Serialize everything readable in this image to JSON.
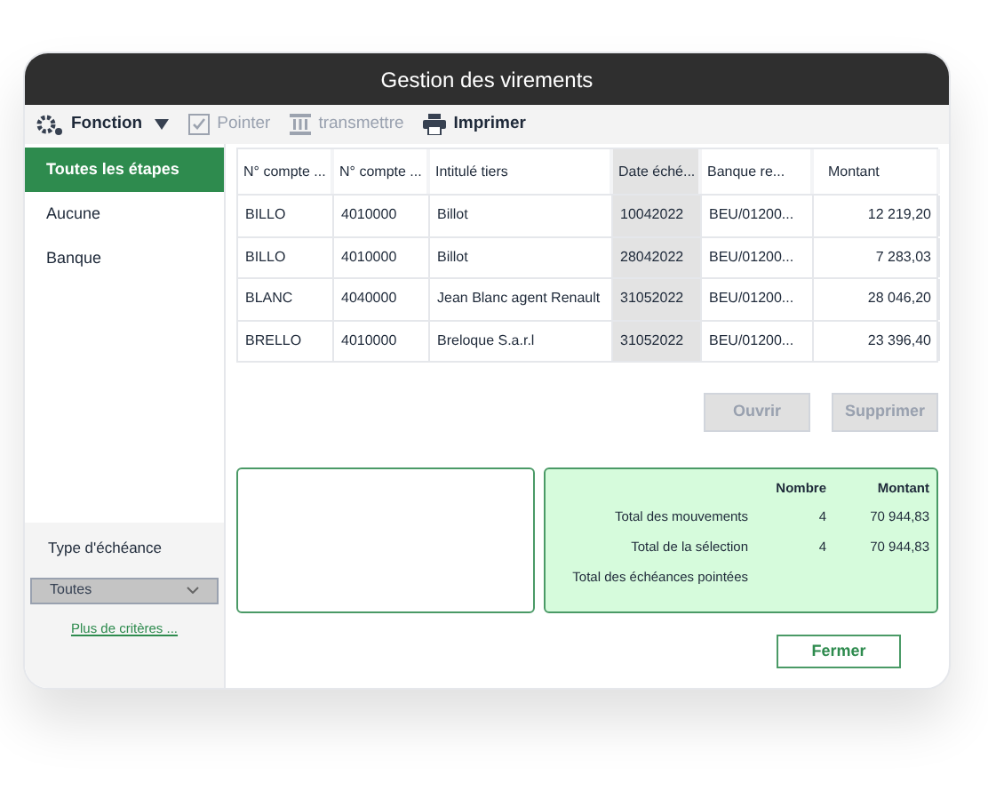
{
  "window": {
    "title": "Gestion des virements"
  },
  "toolbar": [
    {
      "kind": "menu",
      "label": "Fonction",
      "disabled": false
    },
    {
      "kind": "check",
      "label": "Pointer",
      "disabled": true
    },
    {
      "kind": "bank",
      "label": "transmettre",
      "disabled": true
    },
    {
      "kind": "print",
      "label": "Imprimer",
      "disabled": false
    }
  ],
  "sidebar": {
    "items": [
      {
        "label": "Toutes les étapes",
        "selected": true
      },
      {
        "label": "Aucune",
        "selected": false
      },
      {
        "label": "Banque",
        "selected": false
      }
    ],
    "filter_label": "Type d'échéance",
    "filter_value": "Toutes",
    "more_link": "Plus de critères ..."
  },
  "table": {
    "columns": [
      {
        "label": "N° compte ...",
        "sorted": false
      },
      {
        "label": "N° compte ...",
        "sorted": false
      },
      {
        "label": "Intitulé tiers",
        "sorted": false
      },
      {
        "label": "Date éché...",
        "sorted": true
      },
      {
        "label": "Banque re...",
        "sorted": false
      },
      {
        "label": "Montant",
        "sorted": false
      }
    ],
    "rows": [
      [
        "BILLO",
        "4010000",
        "Billot",
        "10042022",
        "BEU/01200...",
        "12 219,20"
      ],
      [
        "BILLO",
        "4010000",
        "Billot",
        "28042022",
        "BEU/01200...",
        "7 283,03"
      ],
      [
        "BLANC",
        "4040000",
        "Jean Blanc agent Renault",
        "31052022",
        "BEU/01200...",
        "28 046,20"
      ],
      [
        "BRELLO",
        "4010000",
        "Breloque S.a.r.l",
        "31052022",
        "BEU/01200...",
        "23 396,40"
      ]
    ]
  },
  "actions": [
    {
      "label": "Ouvrir",
      "disabled": true
    },
    {
      "label": "Supprimer",
      "disabled": true
    }
  ],
  "totals": {
    "headers": [
      "Nombre",
      "Montant"
    ],
    "rows": [
      {
        "label": "Total des mouvements",
        "count": "4",
        "amount": "70 944,83"
      },
      {
        "label": "Total de la sélection",
        "count": "4",
        "amount": "70 944,83"
      },
      {
        "label": "Total des échéances pointées"
      }
    ]
  },
  "close_button": "Fermer"
}
